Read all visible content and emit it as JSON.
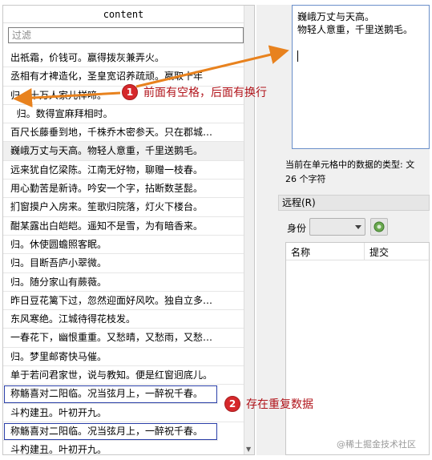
{
  "table": {
    "column_header": "content",
    "filter_placeholder": "过滤",
    "rows": [
      "出祇霜，价钱可。嬴得拨灰兼弄火。",
      "丞相有才裨造化，圣皇宽诏养疏顽。嬴取十年",
      "归。十万人家儿样啼。",
      "  归。数得宣麻拜相时。",
      "百尺长藤垂到地，千株乔木密参天。只在郡城…",
      "巍峨万丈与天高。物轻人意重，千里送鹅毛。",
      "远来犹自忆梁陈。江南无好物，聊赠一枝春。",
      "用心勤苦是新诗。吟安一个字，拈断数茎髭。",
      "扪窗摸户入房来。笙歌归院落，灯火下楼台。",
      "酣某露出白皑皑。遥知不是雪，为有暗香来。",
      "归。休使圆蟾照客眠。",
      "归。目断吾庐小翠微。",
      "归。随分家山有蕨薇。",
      "昨日豆花篱下过，忽然迎面好风吹。独自立多…",
      "东风寒绝。江城待得花枝发。",
      "一春花下，幽恨重重。又愁晴，又愁雨，又愁…",
      "归。梦里邮寄快马催。",
      "单于若问君家世，说与教知。便是红窗迥底儿。",
      "称觞喜对二阳临。况当弦月上，一醉祝千春。",
      "斗杓建丑。叶初开九。",
      "称觞喜对二阳临。况当弦月上，一醉祝千春。",
      "斗杓建丑。叶初开九。"
    ]
  },
  "editor": {
    "lines": [
      "巍峨万丈与天高。",
      "物轻人意重，千里送鹅毛。"
    ]
  },
  "info": {
    "type_label": "当前在单元格中的数据的类型: 文",
    "char_count": "26 个字符"
  },
  "remote": {
    "header": "远程(R)",
    "identity_label": "身份",
    "columns": [
      "名称",
      "提交"
    ]
  },
  "annotations": {
    "badge1": "1",
    "note1": "前面有空格，后面有换行",
    "badge2": "2",
    "note2": "存在重复数据",
    "color": "#d6282b"
  },
  "watermark": "@稀土掘金技术社区"
}
